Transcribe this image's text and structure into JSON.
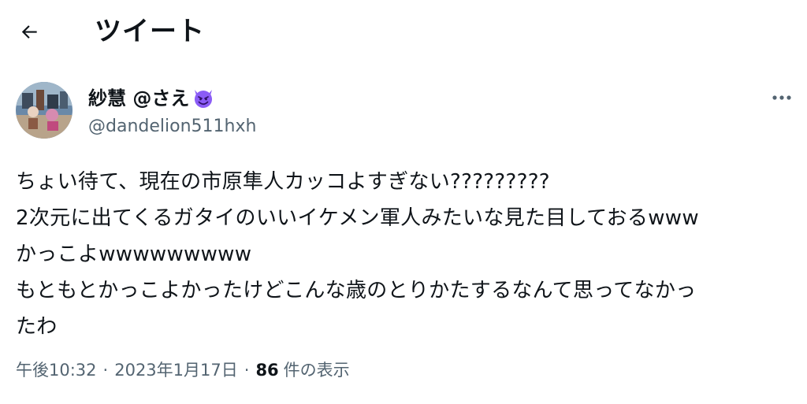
{
  "header": {
    "title": "ツイート",
    "back_icon": "arrow-left-icon"
  },
  "author": {
    "display_name": "紗慧 @さえ",
    "emoji_icon": "smiling-devil-emoji",
    "handle": "@dandelion511hxh",
    "more_icon": "more-horizontal-icon"
  },
  "tweet": {
    "lines": [
      "ちょい待て、現在の市原隼人カッコよすぎない?????????",
      "2次元に出てくるガタイのいいイケメン軍人みたいな見た目しておるwww",
      "かっこよwwwwwwwww",
      "もともとかっこよかったけどこんな歳のとりかたするなんて思ってなかっ",
      "たわ"
    ]
  },
  "meta": {
    "time": "午後10:32",
    "separator": "·",
    "date": "2023年1月17日",
    "view_count": "86",
    "view_label": "件の表示"
  },
  "colors": {
    "text": "#0f1419",
    "secondary": "#536471",
    "devil": "#8b5cf6"
  }
}
